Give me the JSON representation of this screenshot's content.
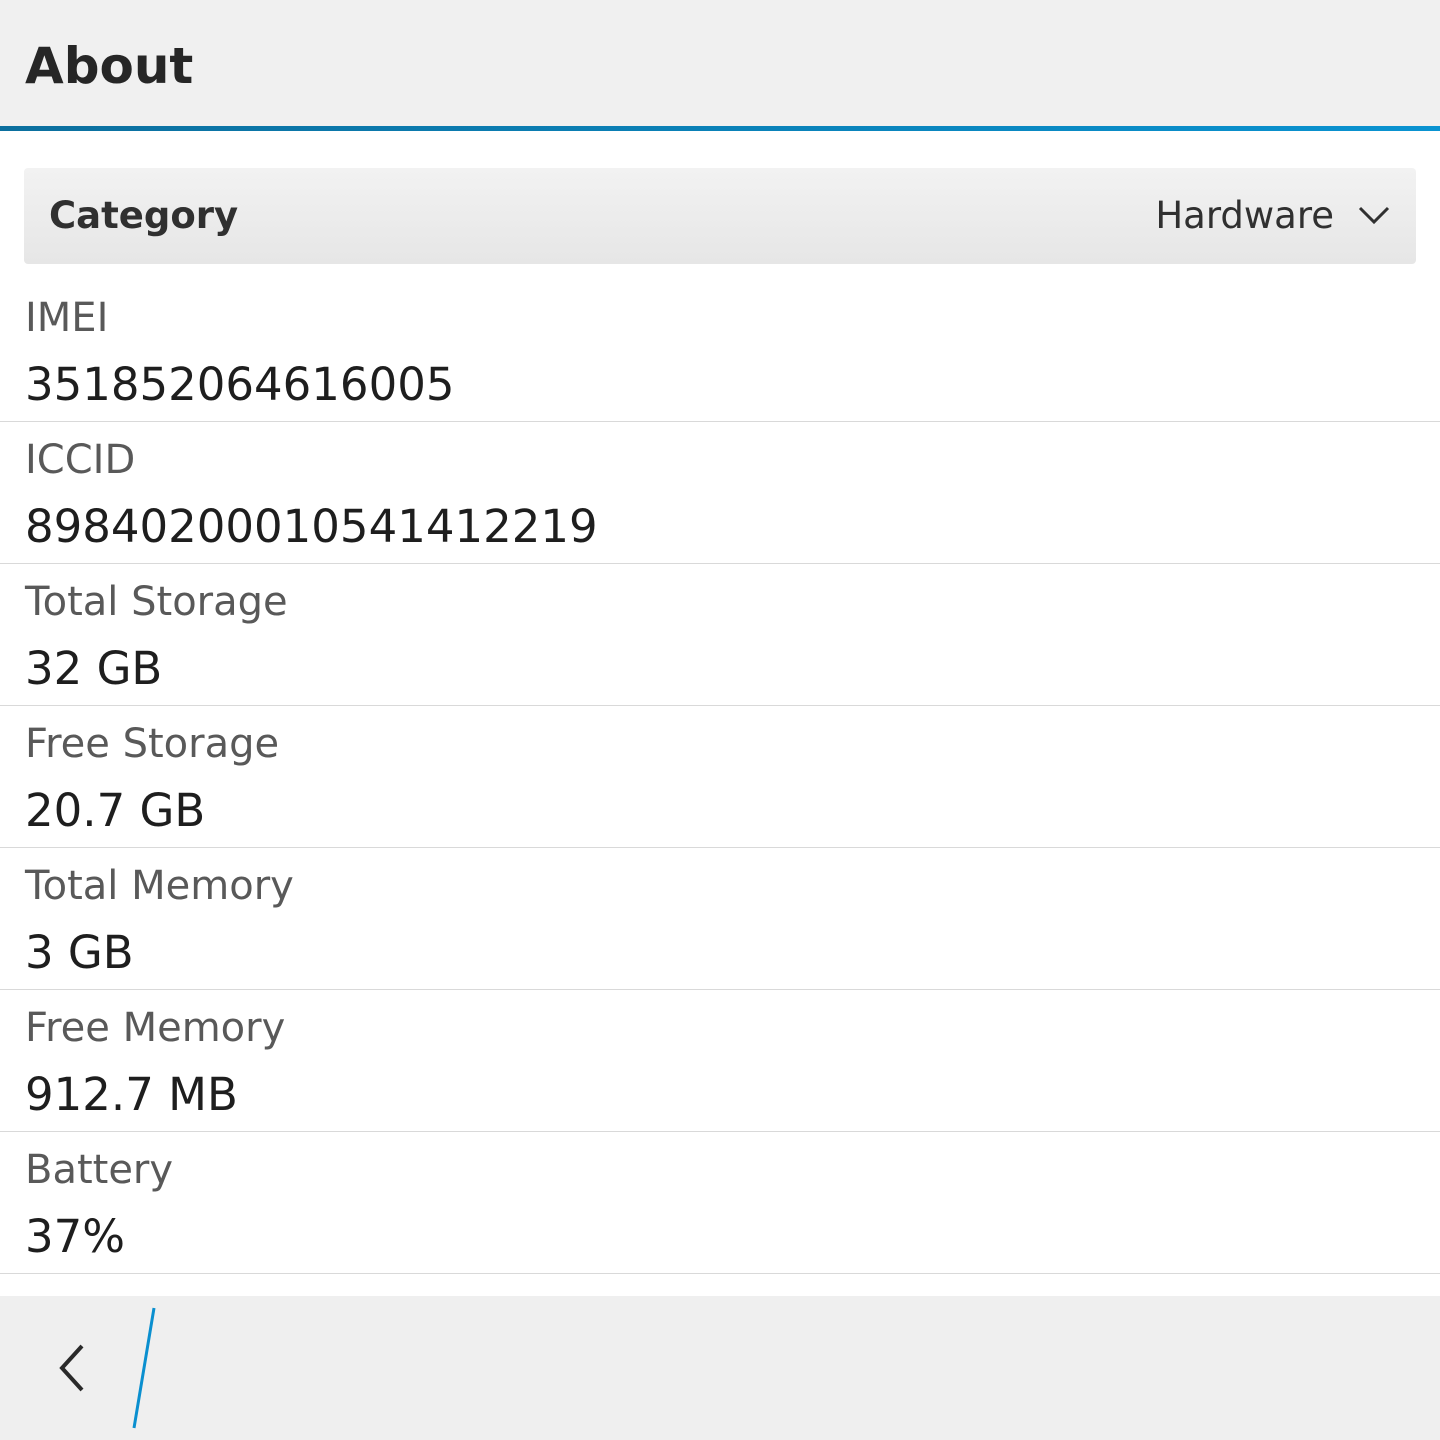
{
  "header": {
    "title": "About"
  },
  "colors": {
    "accent": "#0a8fcf",
    "title_bar_bg": "#f0f0f0",
    "action_bar_bg": "#efefef"
  },
  "category": {
    "label": "Category",
    "value": "Hardware",
    "icon": "chevron-down-icon"
  },
  "items": [
    {
      "label": "IMEI",
      "value": "351852064616005"
    },
    {
      "label": "ICCID",
      "value": "89840200010541412219"
    },
    {
      "label": "Total Storage",
      "value": "32 GB"
    },
    {
      "label": "Free Storage",
      "value": "20.7 GB"
    },
    {
      "label": "Total Memory",
      "value": "3 GB"
    },
    {
      "label": "Free Memory",
      "value": "912.7 MB"
    },
    {
      "label": "Battery",
      "value": "37%"
    }
  ],
  "action_bar": {
    "back_icon": "back-chevron-icon"
  }
}
